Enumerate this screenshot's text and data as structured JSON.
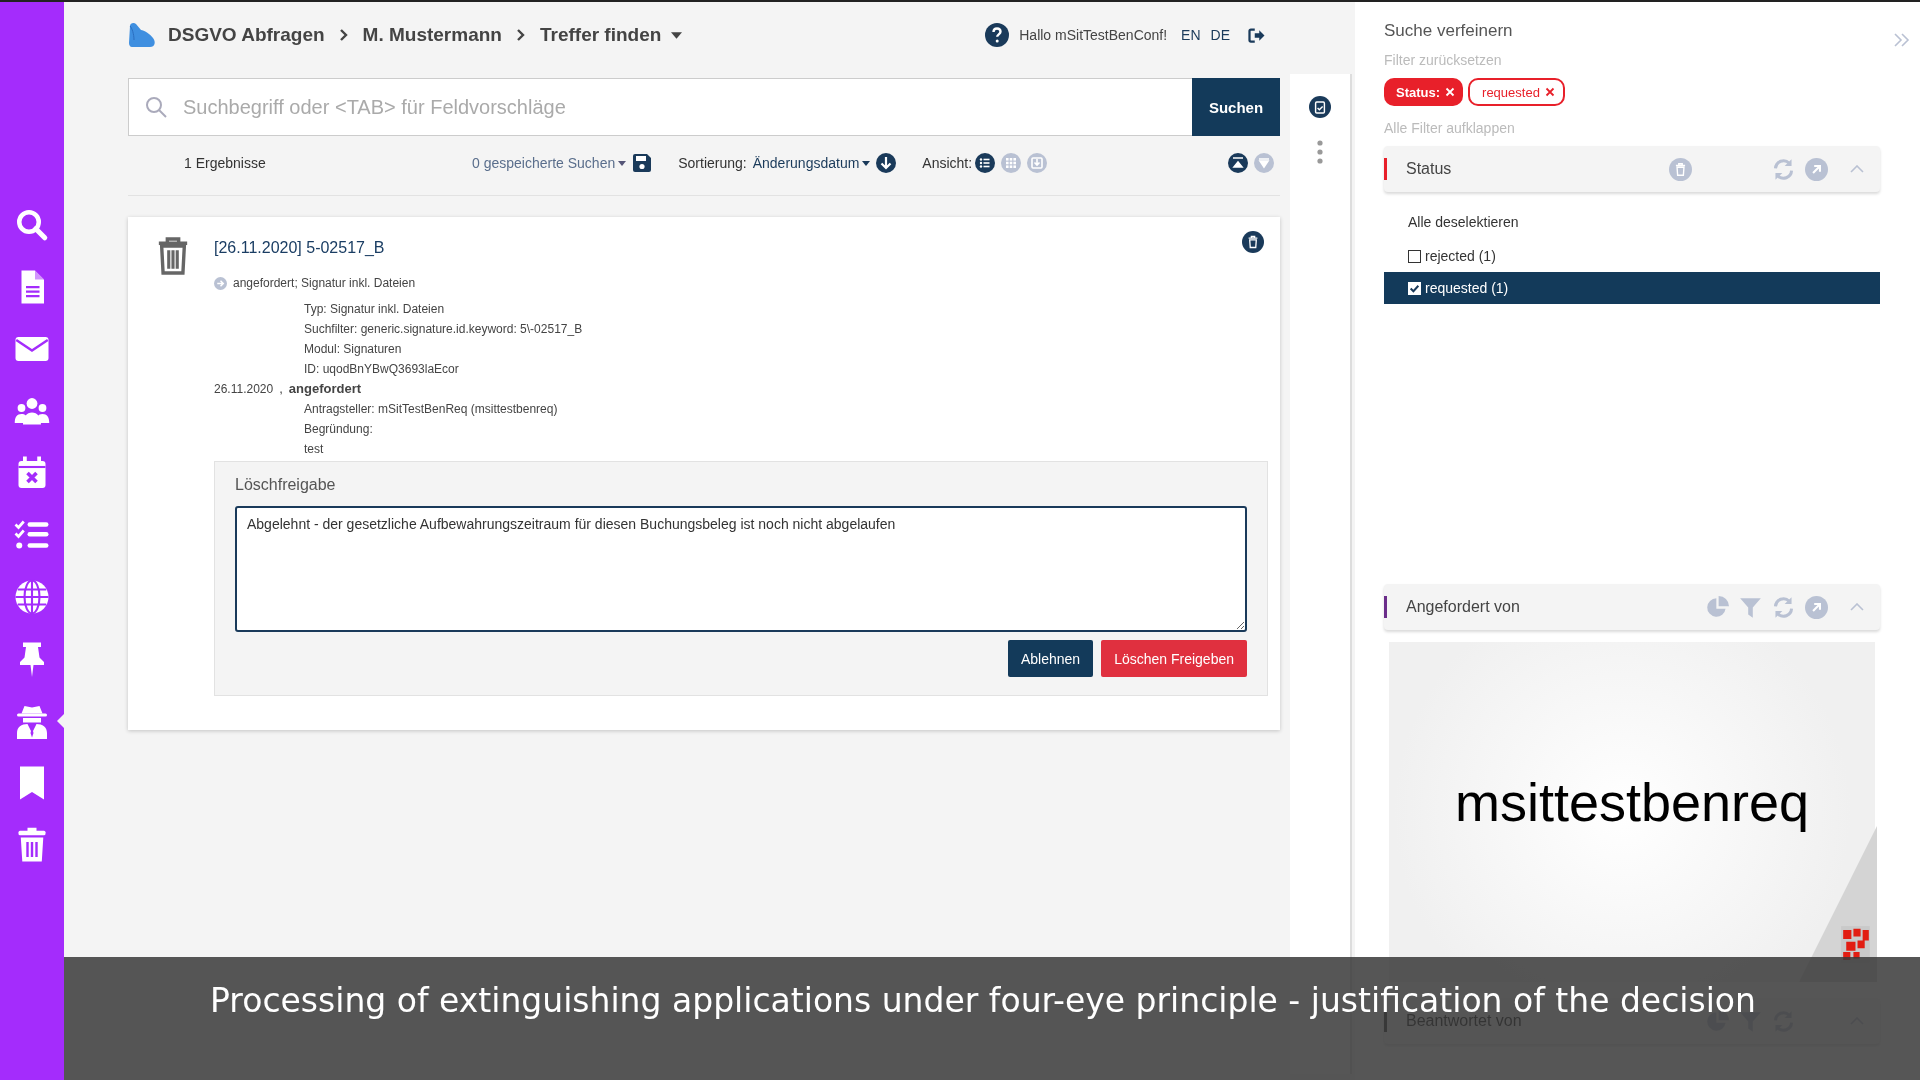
{
  "sidebar": {
    "items": [
      {
        "selected": false
      },
      {
        "selected": false
      },
      {
        "selected": false
      },
      {
        "selected": false
      },
      {
        "selected": false
      },
      {
        "selected": false
      },
      {
        "selected": false
      },
      {
        "selected": false
      },
      {
        "selected": true
      },
      {
        "selected": false
      },
      {
        "selected": false
      }
    ]
  },
  "breadcrumb": [
    "DSGVO Abfragen",
    "M. Mustermann",
    "Treffer finden"
  ],
  "user": {
    "greeting": "Hallo mSitTestBenConf!",
    "languages": [
      "EN",
      "DE"
    ]
  },
  "search": {
    "placeholder": "Suchbegriff oder <TAB> für Feldvorschläge",
    "button": "Suchen"
  },
  "toolbar": {
    "result_count": "1 Ergebnisse",
    "saved_searches": "0 gespeicherte Suchen",
    "sort_label": "Sortierung:",
    "sort_value": "Änderungsdatum",
    "view_label": "Ansicht:",
    "views": [
      {
        "selected": true
      },
      {
        "selected": false
      },
      {
        "selected": false
      }
    ]
  },
  "result": {
    "title": "[26.11.2020] 5-02517_B",
    "summary": "angefordert; Signatur inkl. Dateien",
    "details": [
      "Typ: Signatur inkl. Dateien",
      "Suchfilter: generic.signature.id.keyword: 5\\-02517_B",
      "Modul: Signaturen",
      "ID: uqodBnYBwQ3693laEcor"
    ],
    "event": {
      "date": "26.11.2020",
      "separator": ",",
      "status": "angefordert",
      "lines": [
        "Antragsteller: mSitTestBenReq (msittestbenreq)",
        "Begründung:",
        "test"
      ]
    }
  },
  "approval": {
    "title": "Löschfreigabe",
    "value": "Abgelehnt - der gesetzliche Aufbewahrungszeitraum für diesen Buchungsbeleg ist noch nicht abgelaufen",
    "buttons": [
      {
        "label": "Ablehnen",
        "kind": "primary"
      },
      {
        "label": "Löschen Freigeben",
        "kind": "danger"
      }
    ]
  },
  "filter_panel": {
    "title": "Suche verfeinern",
    "reset": "Filter zurücksetzen",
    "chips": [
      {
        "label": "Status:",
        "kind": "solid"
      },
      {
        "label": "requested",
        "kind": "outline"
      }
    ],
    "expand_all": "Alle Filter aufklappen",
    "sections": [
      {
        "title": "Status",
        "kind": "options",
        "color": "#e8202a",
        "deselect": "Alle deselektieren",
        "options": [
          {
            "label": "rejected (1)",
            "checked": false,
            "selected": false
          },
          {
            "label": "requested (1)",
            "checked": true,
            "selected": true
          }
        ]
      },
      {
        "title": "Angefordert von",
        "kind": "chart",
        "color": "#6b2d8a",
        "chart_label": "msittestbenreq"
      },
      {
        "title": "Beantwortet von",
        "kind": "plain",
        "color": "#2b2b2b"
      }
    ]
  },
  "caption": "Processing of extinguishing applications under four-eye principle - justification of the decision"
}
